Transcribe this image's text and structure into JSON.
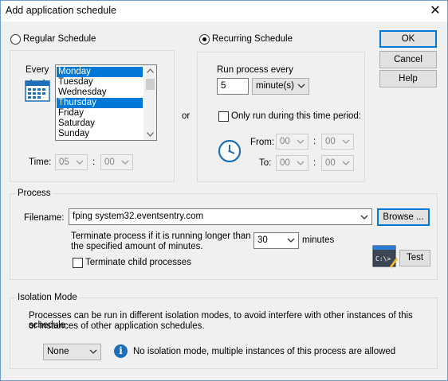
{
  "window": {
    "title": "Add application schedule",
    "close_glyph": "✕"
  },
  "schedule": {
    "regular_label": "Regular Schedule",
    "recurring_label": "Recurring Schedule",
    "selected": "recurring",
    "or_label": "or"
  },
  "regular": {
    "every_label": "Every",
    "days": [
      "Monday",
      "Tuesday",
      "Wednesday",
      "Thursday",
      "Friday",
      "Saturday",
      "Sunday"
    ],
    "selected_days": [
      "Monday",
      "Thursday"
    ],
    "time_label": "Time:",
    "hour": "05",
    "minute": "00",
    "time_sep": ":"
  },
  "recurring": {
    "run_every_label": "Run process every",
    "interval_value": "5",
    "interval_unit": "minute(s)",
    "only_during_label": "Only run during this time period:",
    "only_during_checked": false,
    "from_label": "From:",
    "to_label": "To:",
    "from_hour": "00",
    "from_minute": "00",
    "to_hour": "00",
    "to_minute": "00",
    "sep": ":"
  },
  "buttons": {
    "ok": "OK",
    "cancel": "Cancel",
    "help": "Help"
  },
  "process": {
    "group_label": "Process",
    "filename_label": "Filename:",
    "filename_value": "fping system32.eventsentry.com",
    "browse_label": "Browse ...",
    "terminate_text_1": "Terminate process if it is running longer than",
    "terminate_text_2": "the specified amount of minutes.",
    "terminate_minutes": "30",
    "minutes_label": "minutes",
    "terminate_children_label": "Terminate child processes",
    "terminate_children_checked": false,
    "test_label": "Test"
  },
  "isolation": {
    "group_label": "Isolation Mode",
    "description_1": "Processes can be run in different isolation modes, to avoid interfere with other instances of this schedule",
    "description_2": "or instances of other application schedules.",
    "mode_value": "None",
    "info_text": "No isolation mode, multiple instances of this process are allowed",
    "info_icon_glyph": "i"
  },
  "colors": {
    "accent": "#0078d7",
    "info_icon": "#1e6fb8"
  },
  "icons": {
    "calendar": "calendar-icon",
    "clock": "clock-icon",
    "console": "console-icon",
    "info": "info-icon",
    "dropdown": "chevron-down-icon"
  }
}
